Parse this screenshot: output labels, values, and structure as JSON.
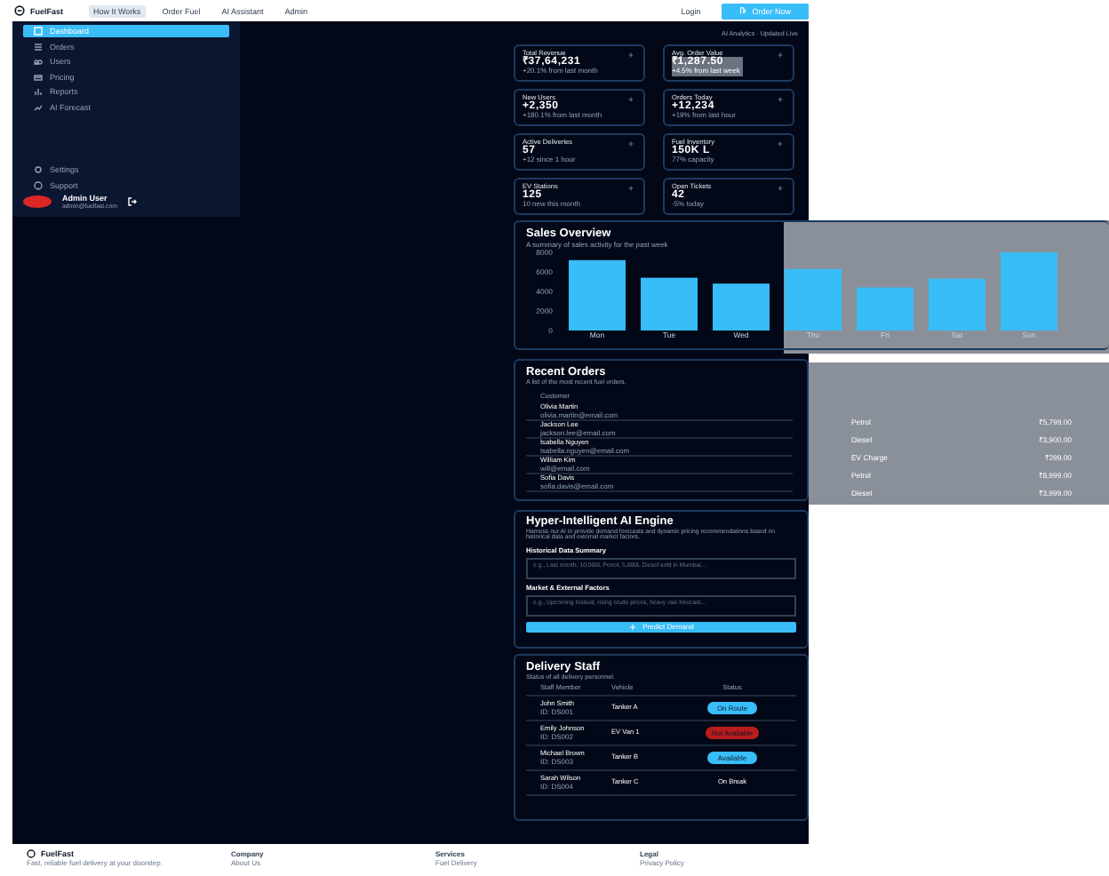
{
  "nav": {
    "brand": "FuelFast",
    "links": [
      {
        "label": "How It Works",
        "selected": true
      },
      {
        "label": "Order Fuel",
        "selected": false
      },
      {
        "label": "AI Assistant",
        "selected": false
      },
      {
        "label": "Admin",
        "selected": false
      }
    ],
    "login": "Login",
    "cta": "Order Now"
  },
  "sidebar": {
    "items": [
      {
        "label": "Dashboard",
        "selected": true
      },
      {
        "label": "Orders",
        "selected": false
      },
      {
        "label": "Users",
        "selected": false
      },
      {
        "label": "Pricing",
        "selected": false
      },
      {
        "label": "Reports",
        "selected": false
      },
      {
        "label": "AI Forecast",
        "selected": false
      }
    ],
    "bottom_items": [
      {
        "label": "Settings"
      },
      {
        "label": "Support"
      }
    ],
    "user": {
      "name": "Admin User",
      "email": "admin@fuelfast.com"
    }
  },
  "header_note": "AI Analytics · Updated Live",
  "stats": [
    {
      "title": "Total Revenue",
      "value": "₹37,64,231",
      "note": "+20.1% from last month",
      "highlighted": false
    },
    {
      "title": "Avg. Order Value",
      "value": "₹1,287.50",
      "note": "+4.5% from last week",
      "highlighted": true
    },
    {
      "title": "New Users",
      "value": "+2,350",
      "note": "+180.1% from last month",
      "highlighted": false
    },
    {
      "title": "Orders Today",
      "value": "+12,234",
      "note": "+19% from last hour",
      "highlighted": false
    },
    {
      "title": "Active Deliveries",
      "value": "57",
      "note": "+12 since 1 hour",
      "highlighted": false
    },
    {
      "title": "Fuel Inventory",
      "value": "150K L",
      "note": "77% capacity",
      "highlighted": false
    },
    {
      "title": "EV Stations",
      "value": "125",
      "note": "10 new this month",
      "highlighted": false
    },
    {
      "title": "Open Tickets",
      "value": "42",
      "note": "-5% today",
      "highlighted": false
    }
  ],
  "sales": {
    "title": "Sales Overview",
    "subtitle": "A summary of sales activity for the past week",
    "chart_data": {
      "type": "bar",
      "categories": [
        "Mon",
        "Tue",
        "Wed",
        "Thu",
        "Fri",
        "Sat",
        "Sun"
      ],
      "series": [
        {
          "color": "#38bdf8",
          "values": [
            7200,
            5400,
            4800,
            6300,
            4400,
            5300,
            8000
          ]
        }
      ],
      "ylim": [
        0,
        8000
      ],
      "yticks": [
        0,
        2000,
        4000,
        6000,
        8000
      ]
    }
  },
  "orders": {
    "title": "Recent Orders",
    "subtitle": "A list of the most recent fuel orders.",
    "column_1": "Customer",
    "rows": [
      {
        "name": "Olivia Martin",
        "email": "olivia.martin@email.com",
        "type": "Petrol",
        "amount": "₹5,799.00"
      },
      {
        "name": "Jackson Lee",
        "email": "jackson.lee@email.com",
        "type": "Diesel",
        "amount": "₹3,900.00"
      },
      {
        "name": "Isabella Nguyen",
        "email": "isabella.nguyen@email.com",
        "type": "EV Charge",
        "amount": "₹299.00"
      },
      {
        "name": "William Kim",
        "email": "will@email.com",
        "type": "Petrol",
        "amount": "₹8,999.00"
      },
      {
        "name": "Sofia Davis",
        "email": "sofia.davis@email.com",
        "type": "Diesel",
        "amount": "₹3,999.00"
      }
    ]
  },
  "ai": {
    "title": "Hyper-Intelligent AI Engine",
    "description": "Harness our AI to provide demand forecasts and dynamic pricing recommendations based on historical data and external market factors.",
    "fields": [
      {
        "label": "Historical Data Summary",
        "placeholder": "e.g., Last month, 10,000L Petrol, 5,000L Diesel sold in Mumbai..."
      },
      {
        "label": "Market & External Factors",
        "placeholder": "e.g., Upcoming festival, rising crude prices, heavy rain forecast..."
      }
    ],
    "button": "Predict Demand"
  },
  "staff": {
    "title": "Delivery Staff",
    "subtitle": "Status of all delivery personnel.",
    "columns": [
      "Staff Member",
      "Vehicle",
      "Status"
    ],
    "rows": [
      {
        "name": "John Smith",
        "id": "ID: DS001",
        "vehicle": "Tanker A",
        "status": {
          "kind": "pill",
          "label": "On Route",
          "color": "#38bdf8"
        }
      },
      {
        "name": "Emily Johnson",
        "id": "ID: DS002",
        "vehicle": "EV Van 1",
        "status": {
          "kind": "pill",
          "label": "Not Available",
          "color": "#b91c1c"
        }
      },
      {
        "name": "Michael Brown",
        "id": "ID: DS003",
        "vehicle": "Tanker B",
        "status": {
          "kind": "pill",
          "label": "Available",
          "color": "#38bdf8"
        }
      },
      {
        "name": "Sarah Wilson",
        "id": "ID: DS004",
        "vehicle": "Tanker C",
        "status": {
          "kind": "text",
          "label": "On Break"
        }
      }
    ]
  },
  "footer": {
    "brand": "FuelFast",
    "tagline": "Fast, reliable fuel delivery at your doorstep.",
    "columns": [
      {
        "heading": "Company",
        "link": "About Us"
      },
      {
        "heading": "Services",
        "link": "Fuel Delivery"
      },
      {
        "heading": "Legal",
        "link": "Privacy Policy"
      }
    ]
  }
}
